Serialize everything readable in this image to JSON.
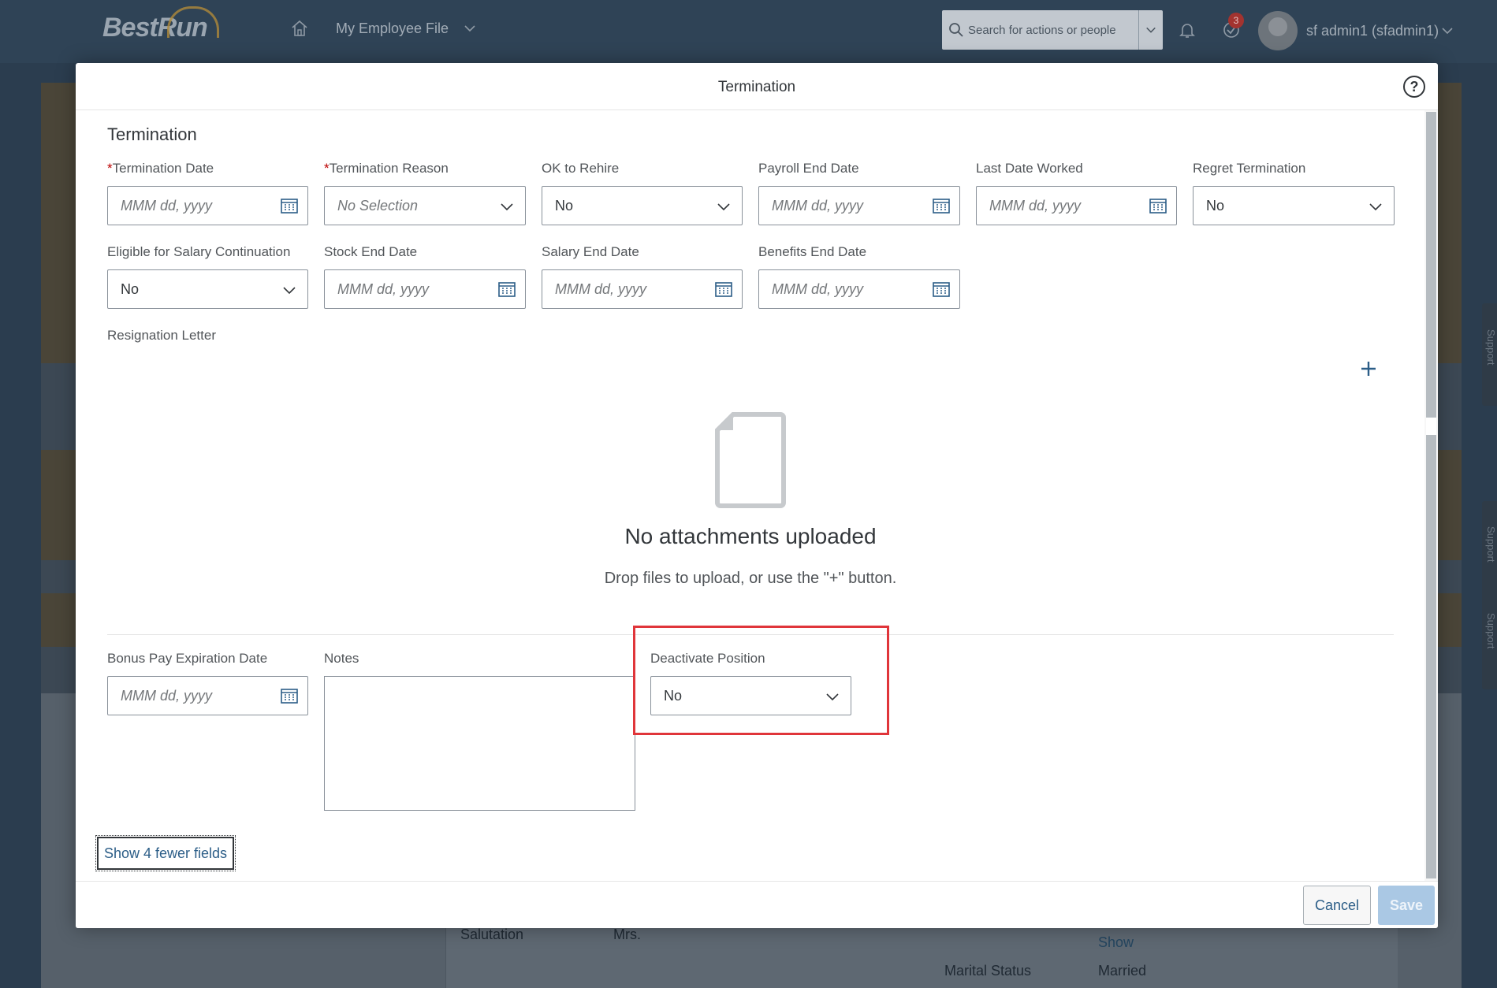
{
  "shell": {
    "logo": "BestRun",
    "nav_title": "My Employee File",
    "search_placeholder": "Search for actions or people",
    "notification_count": "3",
    "user_name": "sf admin1 (sfadmin1)"
  },
  "background": {
    "salutation_label": "Salutation",
    "salutation_value": "Mrs.",
    "show_link": "Show",
    "marital_status_label": "Marital Status",
    "marital_status_value": "Married",
    "support_label": "Support"
  },
  "dialog": {
    "title": "Termination",
    "help": "?",
    "section_title": "Termination",
    "fields": {
      "termination_date": {
        "label": "Termination Date",
        "required": "*",
        "placeholder": "MMM dd, yyyy"
      },
      "termination_reason": {
        "label": "Termination Reason",
        "required": "*",
        "value": "No Selection"
      },
      "ok_to_rehire": {
        "label": "OK to Rehire",
        "value": "No"
      },
      "payroll_end_date": {
        "label": "Payroll End Date",
        "placeholder": "MMM dd, yyyy"
      },
      "last_date_worked": {
        "label": "Last Date Worked",
        "placeholder": "MMM dd, yyyy"
      },
      "regret_termination": {
        "label": "Regret Termination",
        "value": "No"
      },
      "eligible_salary_continuation": {
        "label": "Eligible for Salary Continuation",
        "value": "No"
      },
      "stock_end_date": {
        "label": "Stock End Date",
        "placeholder": "MMM dd, yyyy"
      },
      "salary_end_date": {
        "label": "Salary End Date",
        "placeholder": "MMM dd, yyyy"
      },
      "benefits_end_date": {
        "label": "Benefits End Date",
        "placeholder": "MMM dd, yyyy"
      },
      "resignation_letter": {
        "label": "Resignation Letter"
      },
      "bonus_pay_expiration_date": {
        "label": "Bonus Pay Expiration Date",
        "placeholder": "MMM dd, yyyy"
      },
      "notes": {
        "label": "Notes"
      },
      "deactivate_position": {
        "label": "Deactivate Position",
        "value": "No"
      }
    },
    "attachments": {
      "empty_title": "No attachments uploaded",
      "empty_subtitle": "Drop files to upload, or use the \"+\" button."
    },
    "show_fewer_label": "Show 4 fewer fields",
    "cancel_label": "Cancel",
    "save_label": "Save"
  },
  "colors": {
    "accent": "#2b5d87",
    "required": "#bb0000",
    "highlight": "#e0353a",
    "save_disabled": "#aac8e4"
  }
}
